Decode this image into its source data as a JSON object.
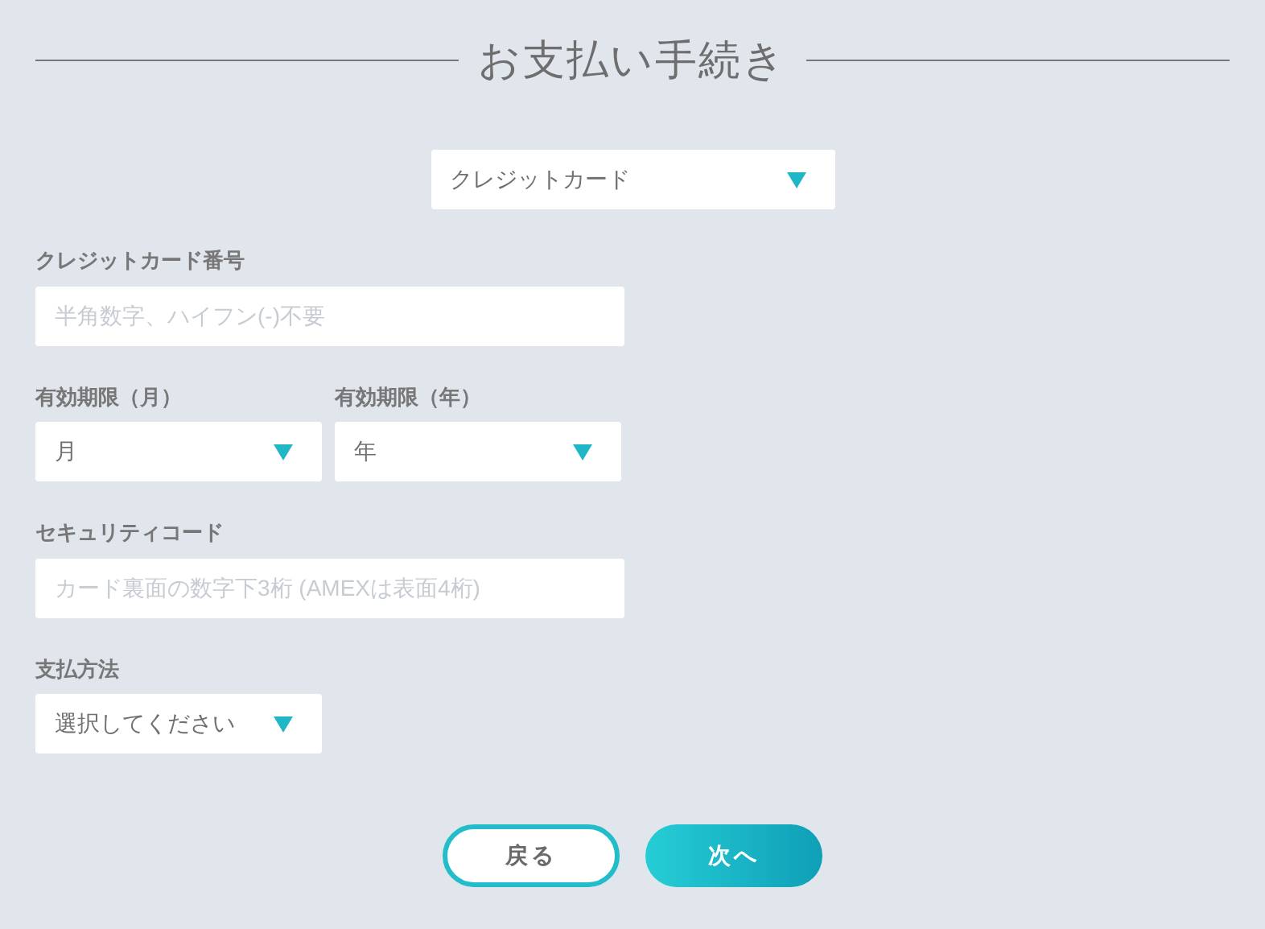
{
  "title": "お支払い手続き",
  "payment_type": {
    "value": "クレジットカード"
  },
  "rows": [
    [
      {
        "kind": "input",
        "label": "クレジットカード番号",
        "placeholder": "半角数字、ハイフン(-)不要"
      }
    ],
    [
      {
        "kind": "select",
        "label": "有効期限（月）",
        "value": "月"
      },
      {
        "kind": "select",
        "label": "有効期限（年）",
        "value": "年"
      }
    ],
    [
      {
        "kind": "input",
        "label": "セキュリティコード",
        "placeholder": "カード裏面の数字下3桁 (AMEXは表面4桁)"
      }
    ],
    [
      {
        "kind": "select",
        "label": "支払方法",
        "value": "選択してください"
      }
    ]
  ],
  "buttons": [
    {
      "label": "戻る",
      "kind": "secondary"
    },
    {
      "label": "次へ",
      "kind": "primary"
    }
  ]
}
